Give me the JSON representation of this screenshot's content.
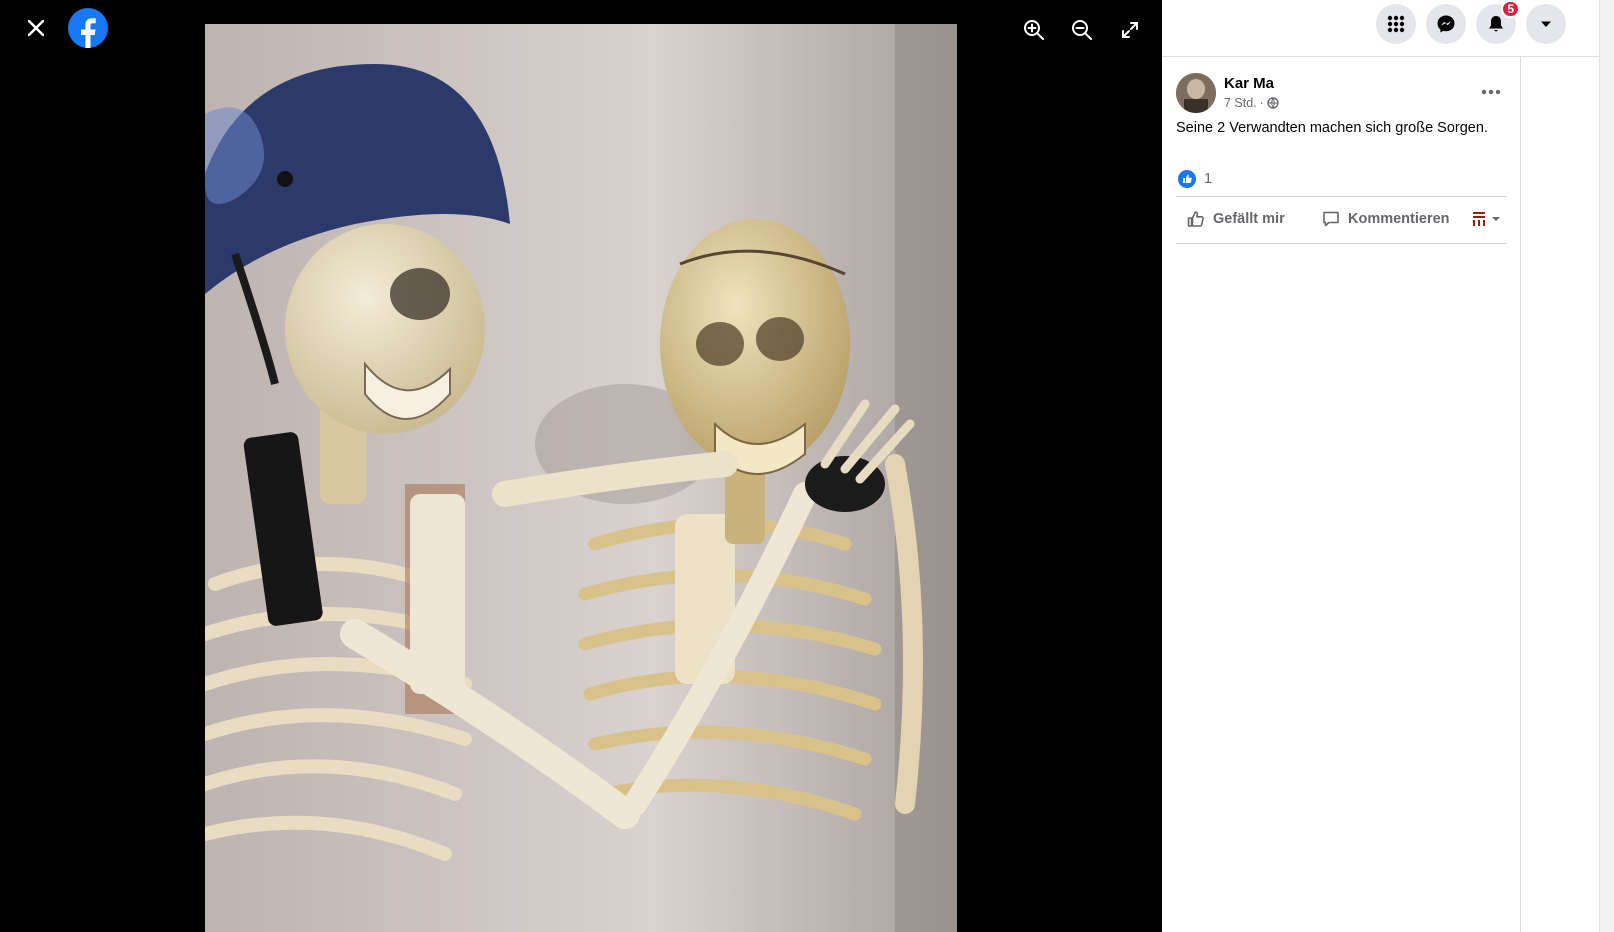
{
  "viewer": {
    "close_icon": "close-icon",
    "logo_icon": "facebook-logo-icon",
    "tools": [
      "zoom-in-icon",
      "zoom-out-icon",
      "fullscreen-icon"
    ],
    "photo_alt": "Zwei Skelette, eines mit Helm"
  },
  "header": {
    "notifications_badge": "5"
  },
  "post": {
    "author": "Kar Ma",
    "time": "7 Std.",
    "separator": "·",
    "text": "Seine 2 Verwandten machen sich große Sorgen.",
    "like_count": "1",
    "like_label": "Gefällt mir",
    "comment_label": "Kommentieren"
  },
  "colors": {
    "brand": "#1877f2",
    "badge": "#e41e3f"
  }
}
